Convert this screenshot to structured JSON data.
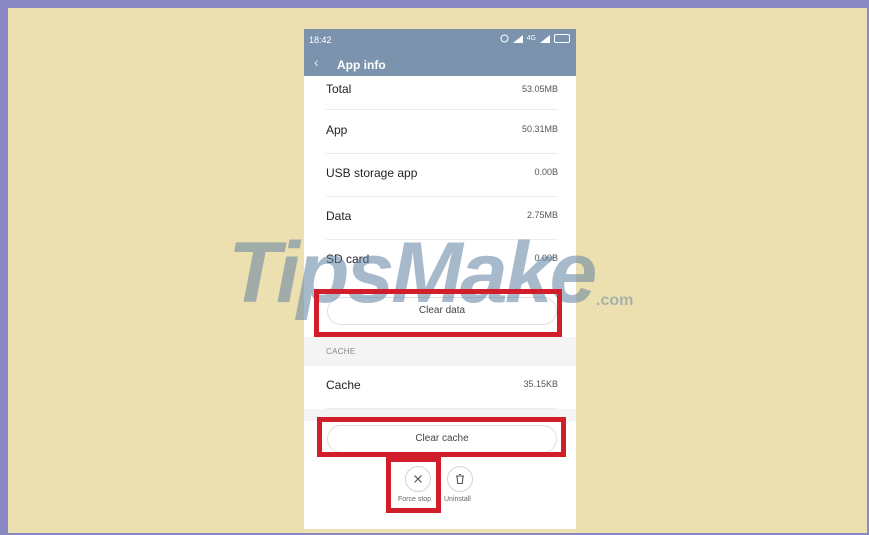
{
  "status": {
    "time": "18:42",
    "network": "4G"
  },
  "appbar": {
    "back_icon": "chevron-left-icon",
    "title": "App info"
  },
  "storage": [
    {
      "label": "Total",
      "value": "53.05MB"
    },
    {
      "label": "App",
      "value": "50.31MB"
    },
    {
      "label": "USB storage app",
      "value": "0.00B"
    },
    {
      "label": "Data",
      "value": "2.75MB"
    },
    {
      "label": "SD card",
      "value": "0.00B"
    }
  ],
  "clear_data_label": "Clear data",
  "cache": {
    "section_label": "CACHE",
    "label": "Cache",
    "value": "35.15KB",
    "clear_label": "Clear cache"
  },
  "actions": {
    "force_stop_label": "Force stop",
    "uninstall_label": "Uninstall"
  },
  "watermark": {
    "text": "TipsMake",
    "suffix": ".com"
  },
  "colors": {
    "highlight": "#d11e2a",
    "appbar": "#7b93ad",
    "background": "#ede0b0",
    "frame": "#8a88c2"
  }
}
